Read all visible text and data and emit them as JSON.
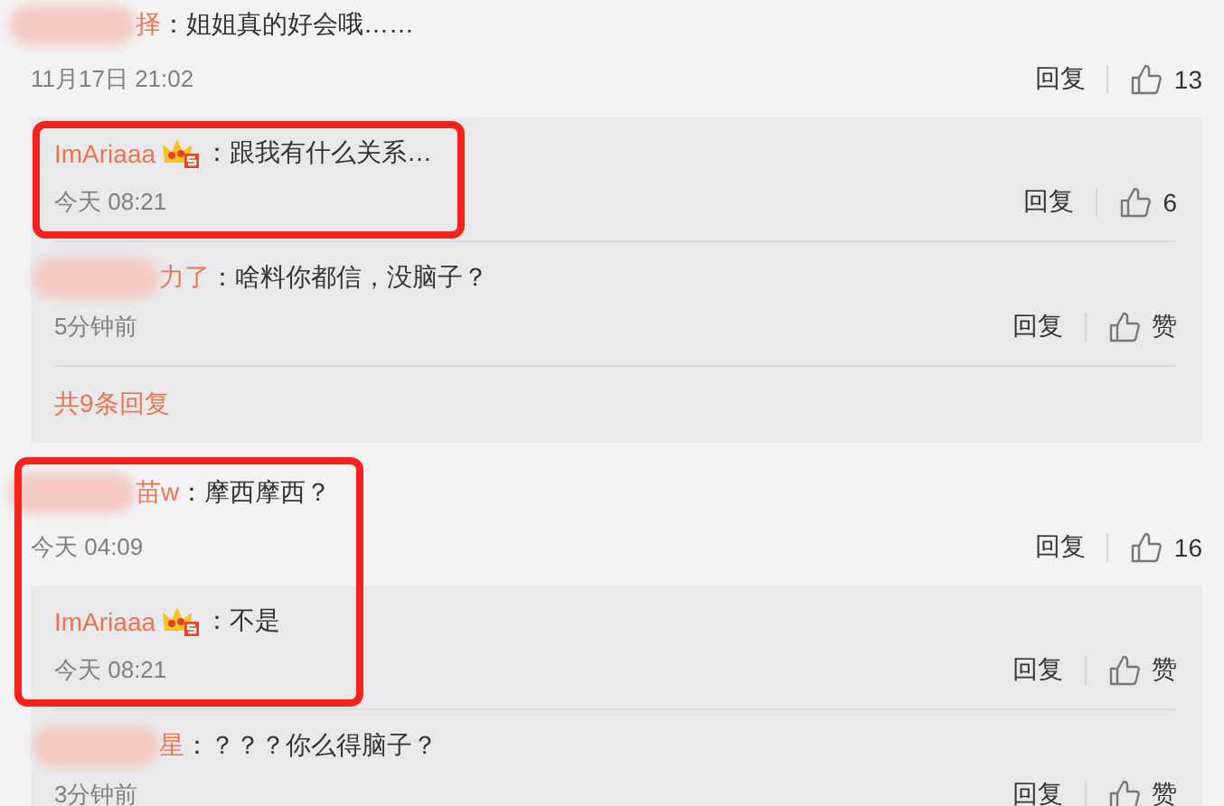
{
  "comments": [
    {
      "author": "择",
      "redacted": true,
      "text": "：姐姐真的好会哦……",
      "time": "11月17日 21:02",
      "reply_label": "回复",
      "like_label": "13",
      "highlighted": false,
      "replies": [
        {
          "author": "ImAriaaa",
          "redacted": false,
          "badge": true,
          "text": "：跟我有什么关系…",
          "time": "今天 08:21",
          "reply_label": "回复",
          "like_label": "6",
          "highlighted": true
        },
        {
          "author": "力了",
          "redacted": true,
          "badge": false,
          "text": "：啥料你都信，没脑子？",
          "time": "5分钟前",
          "reply_label": "回复",
          "like_label": "赞",
          "highlighted": false
        }
      ],
      "more": "共9条回复"
    },
    {
      "author": "苗w",
      "redacted": true,
      "text": "：摩西摩西？",
      "time": "今天 04:09",
      "reply_label": "回复",
      "like_label": "16",
      "highlighted": true,
      "replies": [
        {
          "author": "ImAriaaa",
          "redacted": false,
          "badge": true,
          "text": "：不是",
          "time": "今天 08:21",
          "reply_label": "回复",
          "like_label": "赞",
          "highlighted": true
        },
        {
          "author": "星",
          "redacted": true,
          "badge": false,
          "text": "：？？？你么得脑子？",
          "time": "3分钟前",
          "reply_label": "回复",
          "like_label": "赞",
          "highlighted": false
        }
      ]
    }
  ]
}
